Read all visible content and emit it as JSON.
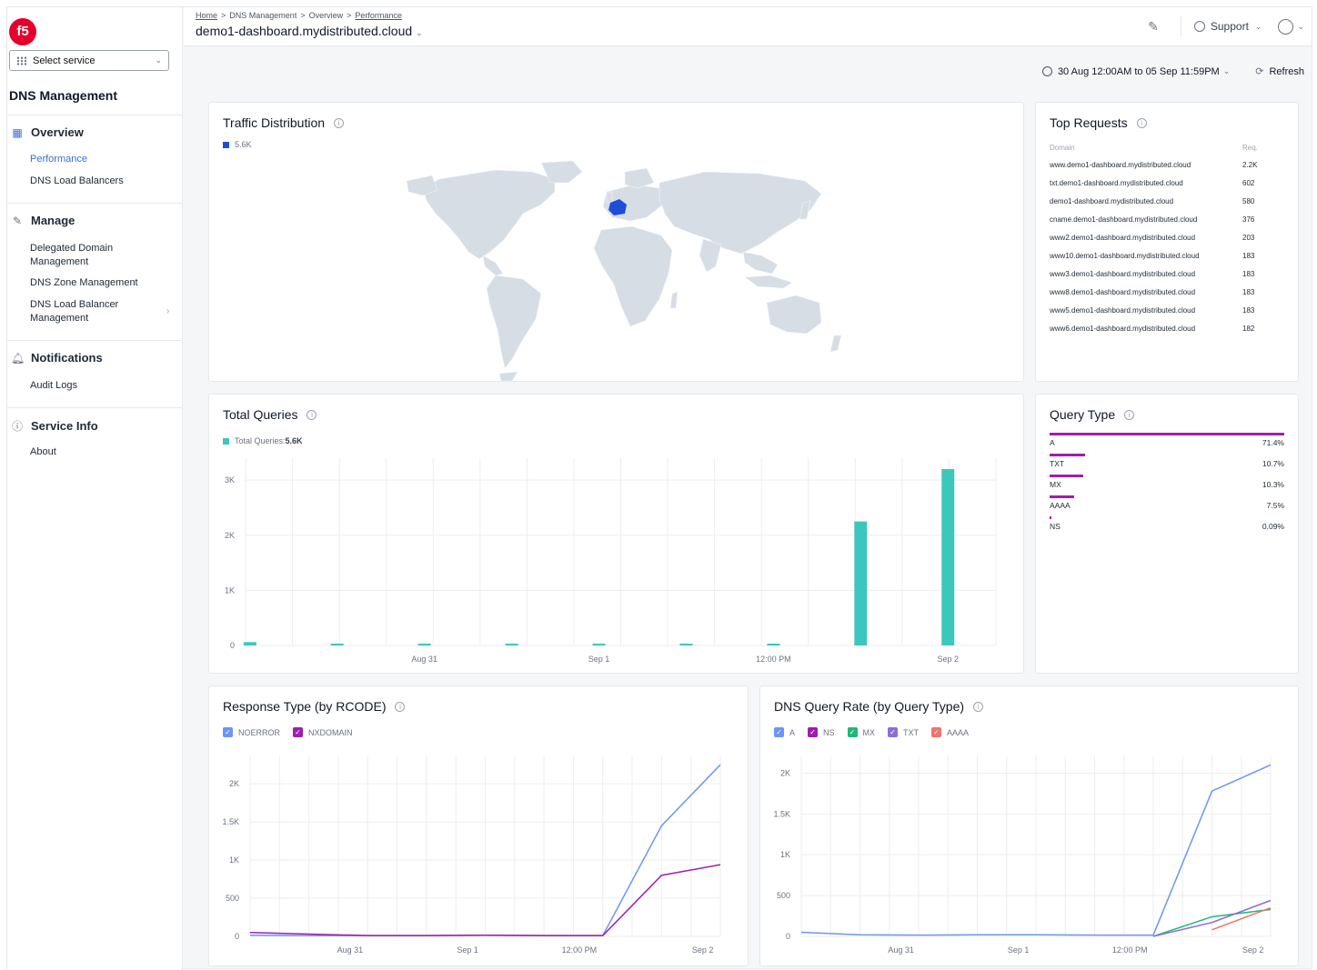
{
  "sidebar": {
    "logo": "f5",
    "select_service": "Select service",
    "title": "DNS Management",
    "overview": {
      "label": "Overview",
      "items": [
        "Performance",
        "DNS Load Balancers"
      ]
    },
    "manage": {
      "label": "Manage",
      "items": [
        "Delegated Domain\nManagement",
        "DNS Zone Management",
        "DNS Load Balancer\nManagement"
      ]
    },
    "notifications": {
      "label": "Notifications",
      "items": [
        "Audit Logs"
      ]
    },
    "service_info": {
      "label": "Service Info",
      "items": [
        "About"
      ]
    }
  },
  "header": {
    "breadcrumb": [
      "Home",
      "DNS Management",
      "Overview",
      "Performance"
    ],
    "site": "demo1-dashboard.mydistributed.cloud",
    "support": "Support"
  },
  "toolbar": {
    "date_range": "30 Aug 12:00AM to 05 Sep 11:59PM",
    "refresh": "Refresh"
  },
  "traffic": {
    "title": "Traffic Distribution",
    "legend": "5.6K",
    "highlight": "#1d4ed8"
  },
  "top_requests": {
    "title": "Top Requests",
    "col_domain": "Domain",
    "col_req": "Req.",
    "rows": [
      {
        "domain": "www.demo1-dashboard.mydistributed.cloud",
        "req": "2.2K"
      },
      {
        "domain": "txt.demo1-dashboard.mydistributed.cloud",
        "req": "602"
      },
      {
        "domain": "demo1-dashboard.mydistributed.cloud",
        "req": "580"
      },
      {
        "domain": "cname.demo1-dashboard.mydistributed.cloud",
        "req": "376"
      },
      {
        "domain": "www2.demo1-dashboard.mydistributed.cloud",
        "req": "203"
      },
      {
        "domain": "www10.demo1-dashboard.mydistributed.cloud",
        "req": "183"
      },
      {
        "domain": "www3.demo1-dashboard.mydistributed.cloud",
        "req": "183"
      },
      {
        "domain": "www8.demo1-dashboard.mydistributed.cloud",
        "req": "183"
      },
      {
        "domain": "www5.demo1-dashboard.mydistributed.cloud",
        "req": "183"
      },
      {
        "domain": "www6.demo1-dashboard.mydistributed.cloud",
        "req": "182"
      }
    ]
  },
  "total_queries": {
    "title": "Total Queries",
    "legend_label": "Total Queries:",
    "legend_value": "5.6K",
    "color": "#3cc7bd"
  },
  "query_type": {
    "title": "Query Type",
    "rows": [
      {
        "label": "A",
        "value": "71.4%",
        "pct": 71.4
      },
      {
        "label": "TXT",
        "value": "10.7%",
        "pct": 10.7
      },
      {
        "label": "MX",
        "value": "10.3%",
        "pct": 10.3
      },
      {
        "label": "AAAA",
        "value": "7.5%",
        "pct": 7.5
      },
      {
        "label": "NS",
        "value": "0.09%",
        "pct": 0.09
      }
    ]
  },
  "response_type": {
    "title": "Response Type (by RCODE)"
  },
  "query_rate": {
    "title": "DNS Query Rate (by Query Type)"
  },
  "chart_data": [
    {
      "type": "bar",
      "title": "Total Queries",
      "x": [
        0,
        1,
        2,
        3,
        4,
        5,
        6,
        7,
        8
      ],
      "x_ticks": [
        {
          "at": 2,
          "label": "Aug 31"
        },
        {
          "at": 4,
          "label": "Sep 1"
        },
        {
          "at": 6,
          "label": "12:00 PM"
        },
        {
          "at": 8,
          "label": "Sep 2"
        }
      ],
      "series": [
        {
          "name": "Total Queries",
          "values": [
            60,
            0,
            25,
            0,
            25,
            0,
            25,
            2250,
            3200
          ]
        }
      ],
      "ylim": [
        0,
        3200
      ],
      "y_ticks": [
        0,
        1000,
        2000,
        3000
      ],
      "y_tick_labels": [
        "0",
        "1K",
        "2K",
        "3K"
      ],
      "grid": true
    },
    {
      "type": "line",
      "title": "Response Type (by RCODE)",
      "x": [
        0,
        1,
        2,
        3,
        4,
        5,
        6,
        7,
        8
      ],
      "x_ticks": [
        {
          "at": 1.7,
          "label": "Aug 31"
        },
        {
          "at": 3.7,
          "label": "Sep 1"
        },
        {
          "at": 5.6,
          "label": "12:00 PM"
        },
        {
          "at": 7.7,
          "label": "Sep 2"
        }
      ],
      "series": [
        {
          "name": "NOERROR",
          "color": "#6b96f5",
          "values": [
            15,
            10,
            10,
            10,
            15,
            10,
            10,
            1450,
            2250
          ]
        },
        {
          "name": "NXDOMAIN",
          "color": "#a21caf",
          "values": [
            50,
            30,
            10,
            10,
            15,
            10,
            10,
            800,
            940
          ]
        }
      ],
      "ylim": [
        0,
        2300
      ],
      "y_ticks": [
        0,
        500,
        1000,
        1500,
        2000
      ],
      "y_tick_labels": [
        "0",
        "500",
        "1K",
        "1.5K",
        "2K"
      ],
      "grid": true
    },
    {
      "type": "line",
      "title": "DNS Query Rate (by Query Type)",
      "x": [
        0,
        1,
        2,
        3,
        4,
        5,
        6,
        7,
        8
      ],
      "x_ticks": [
        {
          "at": 1.7,
          "label": "Aug 31"
        },
        {
          "at": 3.7,
          "label": "Sep 1"
        },
        {
          "at": 5.6,
          "label": "12:00 PM"
        },
        {
          "at": 7.7,
          "label": "Sep 2"
        }
      ],
      "series": [
        {
          "name": "A",
          "color": "#6b96f5",
          "values": [
            50,
            20,
            15,
            20,
            20,
            15,
            15,
            1780,
            2100
          ]
        },
        {
          "name": "NS",
          "color": "#a21caf",
          "values": [
            null,
            null,
            null,
            null,
            null,
            null,
            0,
            null,
            null
          ]
        },
        {
          "name": "MX",
          "color": "#1fb87a",
          "values": [
            null,
            null,
            null,
            null,
            null,
            null,
            0,
            240,
            330
          ]
        },
        {
          "name": "TXT",
          "color": "#8b6fd6",
          "values": [
            null,
            null,
            null,
            null,
            null,
            null,
            0,
            170,
            440
          ]
        },
        {
          "name": "AAAA",
          "color": "#f0746a",
          "values": [
            null,
            null,
            null,
            null,
            null,
            null,
            null,
            80,
            350
          ]
        }
      ],
      "ylim": [
        0,
        2150
      ],
      "y_ticks": [
        0,
        500,
        1000,
        1500,
        2000
      ],
      "y_tick_labels": [
        "0",
        "500",
        "1K",
        "1.5K",
        "2K"
      ],
      "grid": true
    }
  ]
}
